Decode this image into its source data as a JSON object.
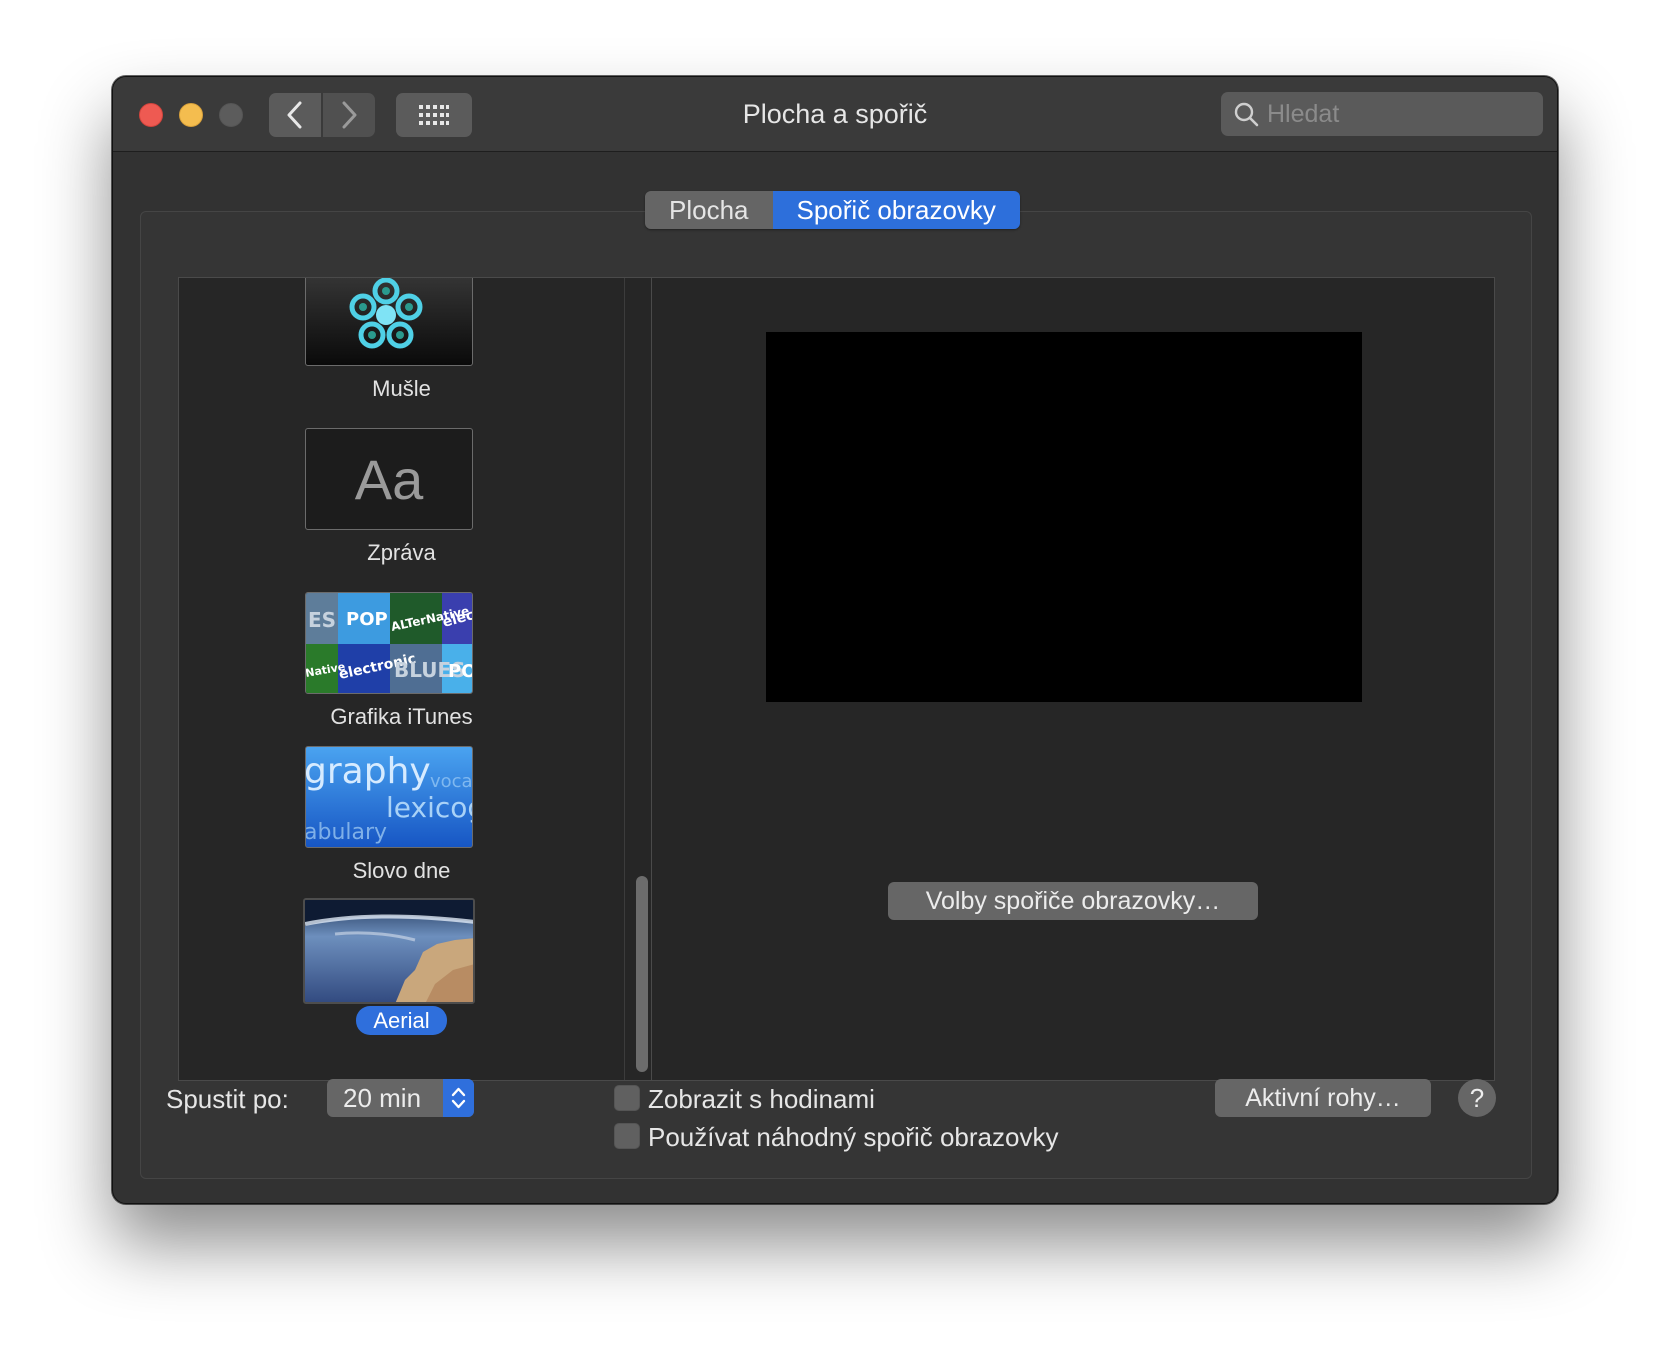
{
  "window": {
    "title": "Plocha a spořič",
    "search_placeholder": "Hledat"
  },
  "tabs": [
    {
      "label": "Plocha",
      "active": false
    },
    {
      "label": "Spořič obrazovky",
      "active": true
    }
  ],
  "screensavers": [
    {
      "label": "Mušle",
      "selected": false,
      "icon": "shell-thumbnail"
    },
    {
      "label": "Zpráva",
      "selected": false,
      "icon": "message-thumbnail",
      "thumb_text": "Aa"
    },
    {
      "label": "Grafika iTunes",
      "selected": false,
      "icon": "itunes-artwork-thumbnail",
      "thumb_words": [
        "ES",
        "POP",
        "ALTerNative",
        "electr",
        "Native",
        "electronic",
        "BLUES",
        "PO"
      ]
    },
    {
      "label": "Slovo dne",
      "selected": false,
      "icon": "word-of-day-thumbnail",
      "thumb_words": [
        "graphy",
        "voca",
        "lexicog",
        "abulary"
      ]
    },
    {
      "label": "Aerial",
      "selected": true,
      "icon": "aerial-thumbnail"
    }
  ],
  "preview": {
    "options_button": "Volby spořiče obrazovky…"
  },
  "bottom": {
    "start_after_label": "Spustit po:",
    "start_after_value": "20 min",
    "show_with_clock": "Zobrazit s hodinami",
    "use_random": "Používat náhodný spořič obrazovky",
    "hot_corners": "Aktivní rohy…",
    "help": "?"
  },
  "colors": {
    "accent": "#2f6fdc",
    "window_bg": "#323232",
    "list_bg": "#262626"
  }
}
